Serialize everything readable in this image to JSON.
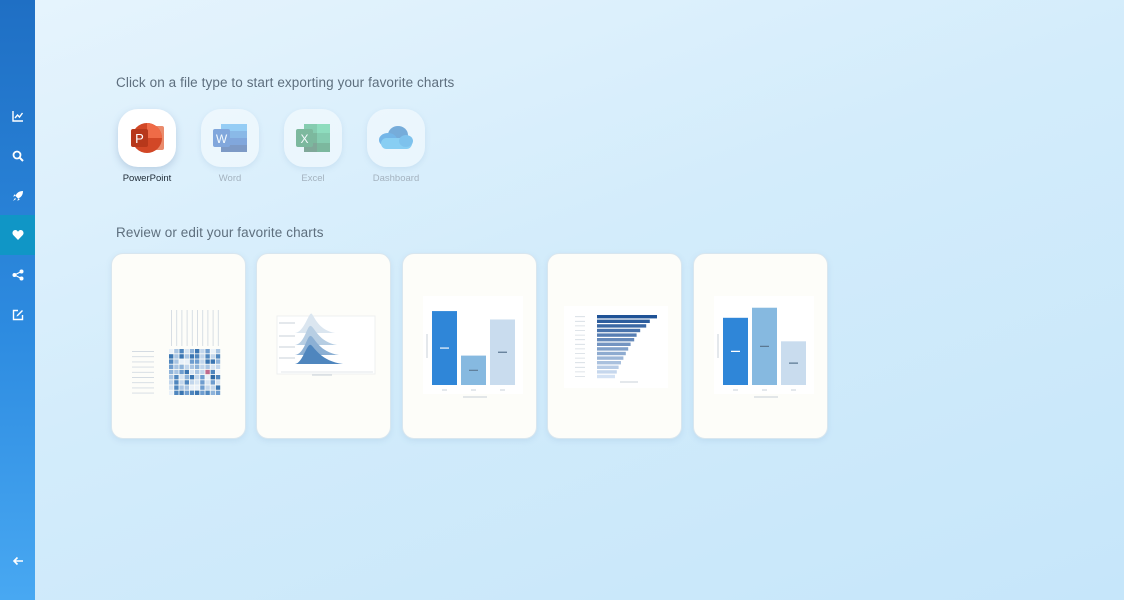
{
  "sidebar": {
    "items": [
      {
        "name": "sidebar-item-charts",
        "icon": "line-chart-icon"
      },
      {
        "name": "sidebar-item-search",
        "icon": "search-icon"
      },
      {
        "name": "sidebar-item-launch",
        "icon": "rocket-icon"
      },
      {
        "name": "sidebar-item-favorites",
        "icon": "heart-icon",
        "active": true
      },
      {
        "name": "sidebar-item-share",
        "icon": "share-icon"
      },
      {
        "name": "sidebar-item-edit",
        "icon": "edit-icon"
      }
    ],
    "back_icon": "arrow-left-icon"
  },
  "export": {
    "heading": "Click on a file type to start exporting your favorite charts",
    "options": [
      {
        "label": "PowerPoint",
        "icon": "powerpoint-icon",
        "letter": "P",
        "selected": true
      },
      {
        "label": "Word",
        "icon": "word-icon",
        "letter": "W"
      },
      {
        "label": "Excel",
        "icon": "excel-icon",
        "letter": "X"
      },
      {
        "label": "Dashboard",
        "icon": "cloud-icon"
      }
    ]
  },
  "favorites": {
    "heading": "Review or edit your favorite charts",
    "cards": [
      {
        "name": "favorite-chart-heatmap",
        "kind": "heatmap"
      },
      {
        "name": "favorite-chart-ridgeline",
        "kind": "ridgeline"
      },
      {
        "name": "favorite-chart-bar-1",
        "kind": "bar",
        "chart_data": {
          "type": "bar",
          "values": [
            88,
            35,
            78
          ],
          "colors": [
            "#2f86d8",
            "#86b9e0",
            "#c9dcee"
          ]
        }
      },
      {
        "name": "favorite-chart-hbar",
        "kind": "hbar",
        "chart_data": {
          "type": "bar",
          "values": [
            100,
            88,
            82,
            72,
            66,
            62,
            56,
            52,
            48,
            44,
            40,
            36,
            33,
            30
          ]
        }
      },
      {
        "name": "favorite-chart-bar-2",
        "kind": "bar",
        "chart_data": {
          "type": "bar",
          "values": [
            80,
            92,
            52
          ],
          "colors": [
            "#2f86d8",
            "#86b9e0",
            "#c9dcee"
          ]
        }
      }
    ]
  },
  "colors": {
    "powerpoint": "#c4391a",
    "word": "#2b5cb8",
    "excel": "#1e7145",
    "onedrive": "#1b78d4",
    "sidebar_active": "#1096c6"
  }
}
